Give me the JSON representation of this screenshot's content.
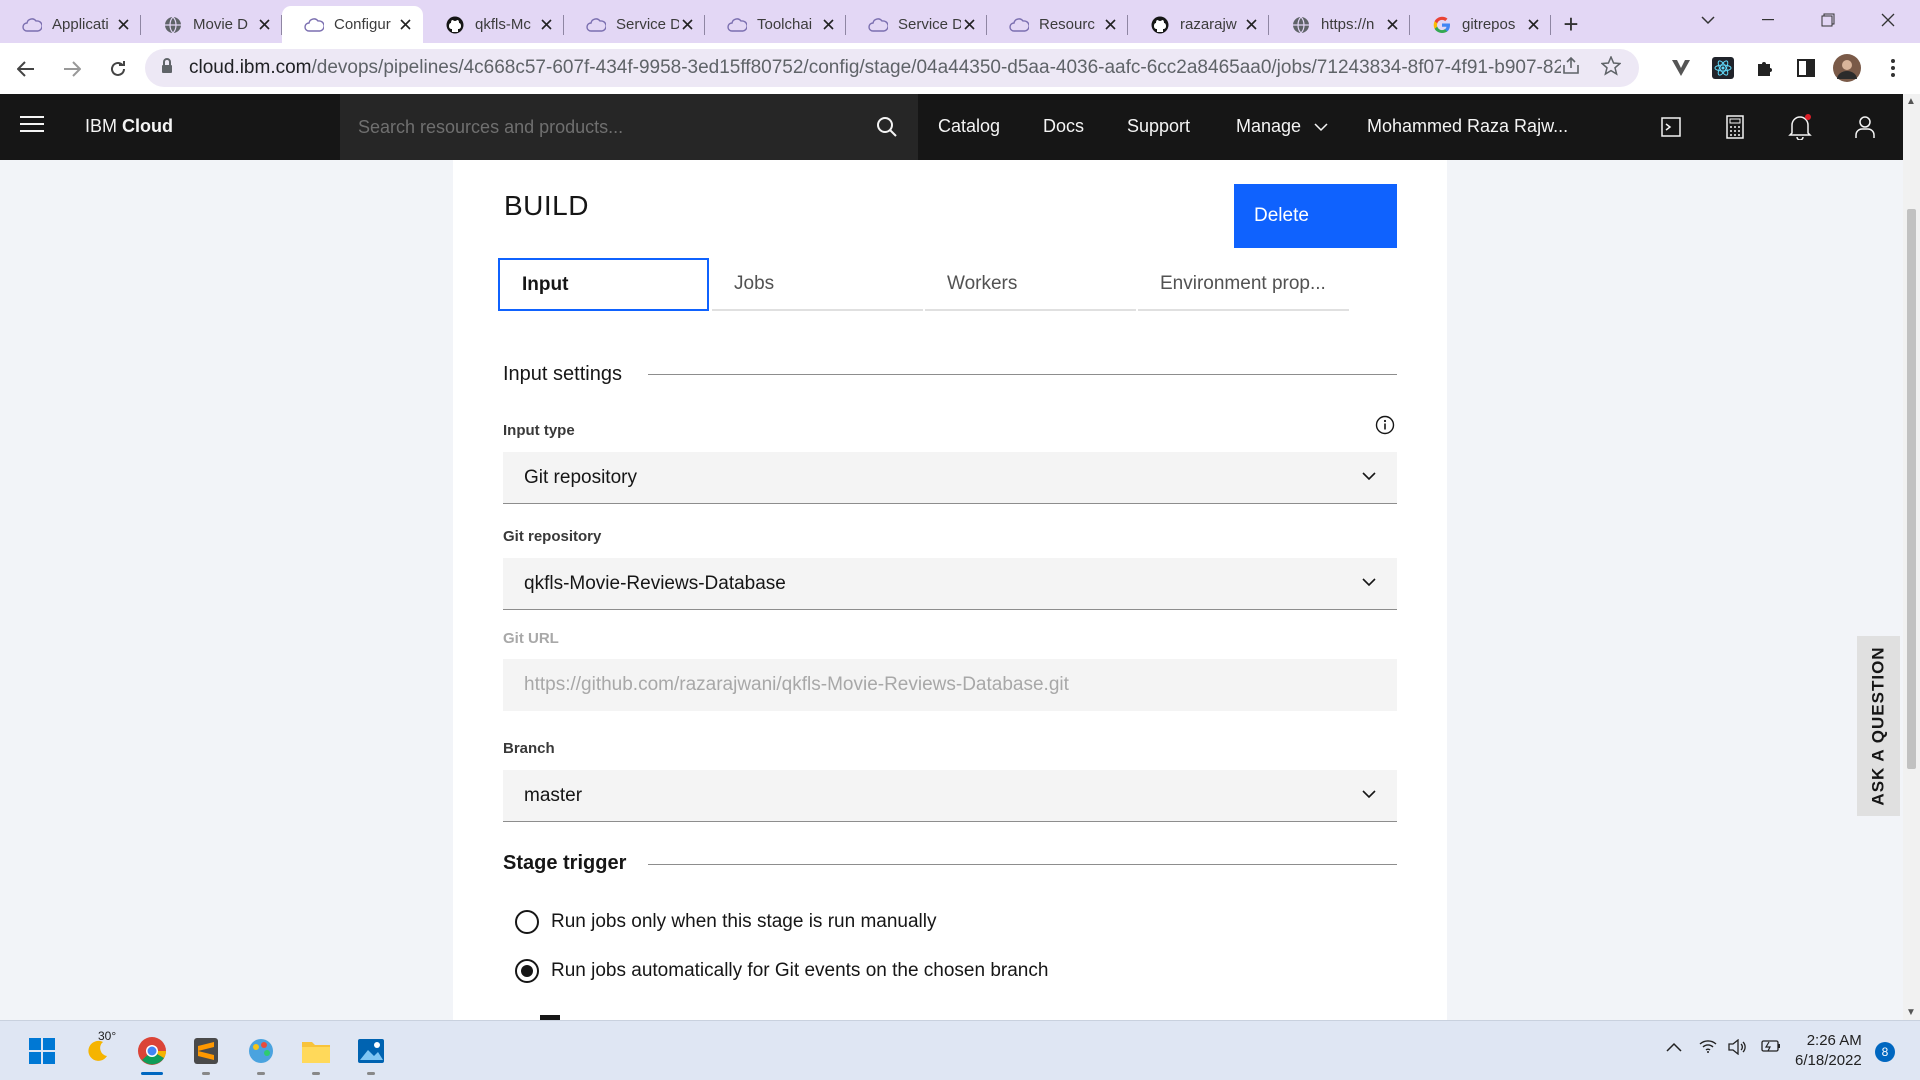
{
  "browser": {
    "tabs": [
      {
        "title": "Applicati",
        "icon": "ibm-cloud-icon",
        "active": false
      },
      {
        "title": "Movie D",
        "icon": "globe-icon",
        "active": false
      },
      {
        "title": "Configur",
        "icon": "ibm-cloud-icon",
        "active": true
      },
      {
        "title": "qkfls-Mc",
        "icon": "github-icon",
        "active": false
      },
      {
        "title": "Service D",
        "icon": "ibm-cloud-icon",
        "active": false
      },
      {
        "title": "Toolchai",
        "icon": "ibm-cloud-icon",
        "active": false
      },
      {
        "title": "Service D",
        "icon": "ibm-cloud-icon",
        "active": false
      },
      {
        "title": "Resourc",
        "icon": "ibm-cloud-icon",
        "active": false
      },
      {
        "title": "razarajw",
        "icon": "github-icon",
        "active": false
      },
      {
        "title": "https://n",
        "icon": "globe-icon",
        "active": false
      },
      {
        "title": "gitrepos",
        "icon": "google-icon",
        "active": false
      }
    ],
    "url_host": "cloud.ibm.com",
    "url_path": "/devops/pipelines/4c668c57-607f-434f-9958-3ed15ff80752/config/stage/04a44350-d5aa-4036-aafc-6cc2a8465aa0/jobs/71243834-8f07-4f91-b907-82..."
  },
  "header": {
    "brand_prefix": "IBM ",
    "brand_bold": "Cloud",
    "search_placeholder": "Search resources and products...",
    "nav": {
      "catalog": "Catalog",
      "docs": "Docs",
      "support": "Support",
      "manage": "Manage",
      "account": "Mohammed Raza Rajw..."
    }
  },
  "stage": {
    "title": "BUILD",
    "delete_label": "Delete",
    "tabs": [
      "Input",
      "Jobs",
      "Workers",
      "Environment prop..."
    ],
    "input_settings_heading": "Input settings",
    "input_type_label": "Input type",
    "input_type_value": "Git repository",
    "git_repo_label": "Git repository",
    "git_repo_value": "qkfls-Movie-Reviews-Database",
    "git_url_label": "Git URL",
    "git_url_value": "https://github.com/razarajwani/qkfls-Movie-Reviews-Database.git",
    "branch_label": "Branch",
    "branch_value": "master",
    "stage_trigger_heading": "Stage trigger",
    "trigger_manual": "Run jobs only when this stage is run manually",
    "trigger_auto": "Run jobs automatically for Git events on the chosen branch",
    "selected_trigger": "auto"
  },
  "ask_question": "ASK A QUESTION",
  "taskbar": {
    "weather_temp": "30°",
    "time": "2:26 AM",
    "date": "6/18/2022",
    "notification_count": "8"
  },
  "colors": {
    "ibm_blue": "#0f62fe",
    "header_bg": "#161616",
    "tab_strip": "#e3d7f5"
  }
}
